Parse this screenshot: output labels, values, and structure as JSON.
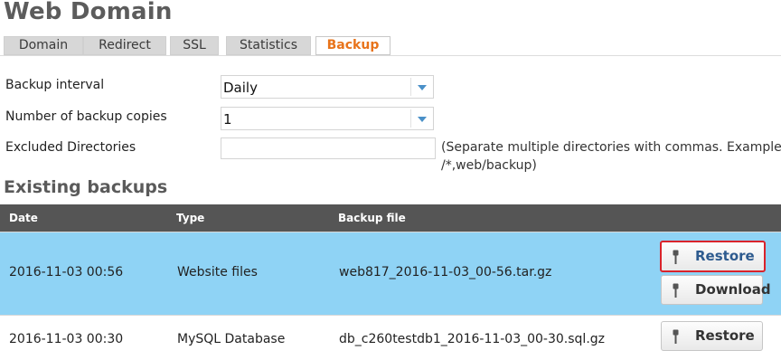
{
  "page": {
    "title": "Web Domain"
  },
  "tabs": [
    {
      "label": "Domain",
      "active": false
    },
    {
      "label": "Redirect",
      "active": false
    },
    {
      "label": "SSL",
      "active": false
    },
    {
      "label": "Statistics",
      "active": false
    },
    {
      "label": "Backup",
      "active": true
    }
  ],
  "form": {
    "backup_interval": {
      "label": "Backup interval",
      "value": "Daily"
    },
    "backup_copies": {
      "label": "Number of backup copies",
      "value": "1"
    },
    "excluded_dirs": {
      "label": "Excluded Directories",
      "value": "",
      "hint_line1": "(Separate multiple directories with commas. Example: v",
      "hint_line2": "/*,web/backup)"
    }
  },
  "existing_backups": {
    "title": "Existing backups",
    "columns": {
      "date": "Date",
      "type": "Type",
      "file": "Backup file"
    },
    "rows": [
      {
        "date": "2016-11-03 00:56",
        "type": "Website files",
        "file": "web817_2016-11-03_00-56.tar.gz",
        "restore_label": "Restore",
        "download_label": "Download"
      },
      {
        "date": "2016-11-03 00:30",
        "type": "MySQL Database",
        "file": "db_c260testdb1_2016-11-03_00-30.sql.gz",
        "restore_label": "Restore"
      }
    ]
  },
  "colors": {
    "active_tab": "#e8731a",
    "header_bg": "#555555",
    "selected_row": "#8fd3f5",
    "highlight_border": "#d9232b"
  },
  "icons": {
    "button": "key-icon",
    "dropdown": "chevron-down-icon"
  }
}
